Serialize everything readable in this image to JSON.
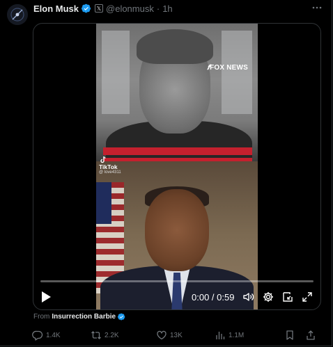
{
  "author": {
    "name": "Elon Musk",
    "handle": "@elonmusk",
    "separator": "·",
    "time": "1h",
    "affiliation_badge": "𝕏"
  },
  "video": {
    "timecode": "0:00 / 0:59",
    "watermark_network": "FOX NEWS",
    "watermark_app": "TikTok",
    "watermark_user": "@ love4311",
    "progress": 0.0
  },
  "source": {
    "prefix": "From",
    "name": "Insurrection Barbie"
  },
  "actions": {
    "replies": "1.4K",
    "reposts": "2.2K",
    "likes": "13K",
    "views": "1.1M"
  },
  "colors": {
    "background": "#000000",
    "verified": "#1d9bf0",
    "muted_text": "#71767b",
    "banner_red": "#c4202e"
  },
  "icons": [
    "more-icon",
    "verified-icon",
    "play-icon",
    "volume-icon",
    "settings-icon",
    "pip-icon",
    "fullscreen-icon",
    "reply-icon",
    "repost-icon",
    "like-icon",
    "views-icon",
    "bookmark-icon",
    "share-icon"
  ]
}
